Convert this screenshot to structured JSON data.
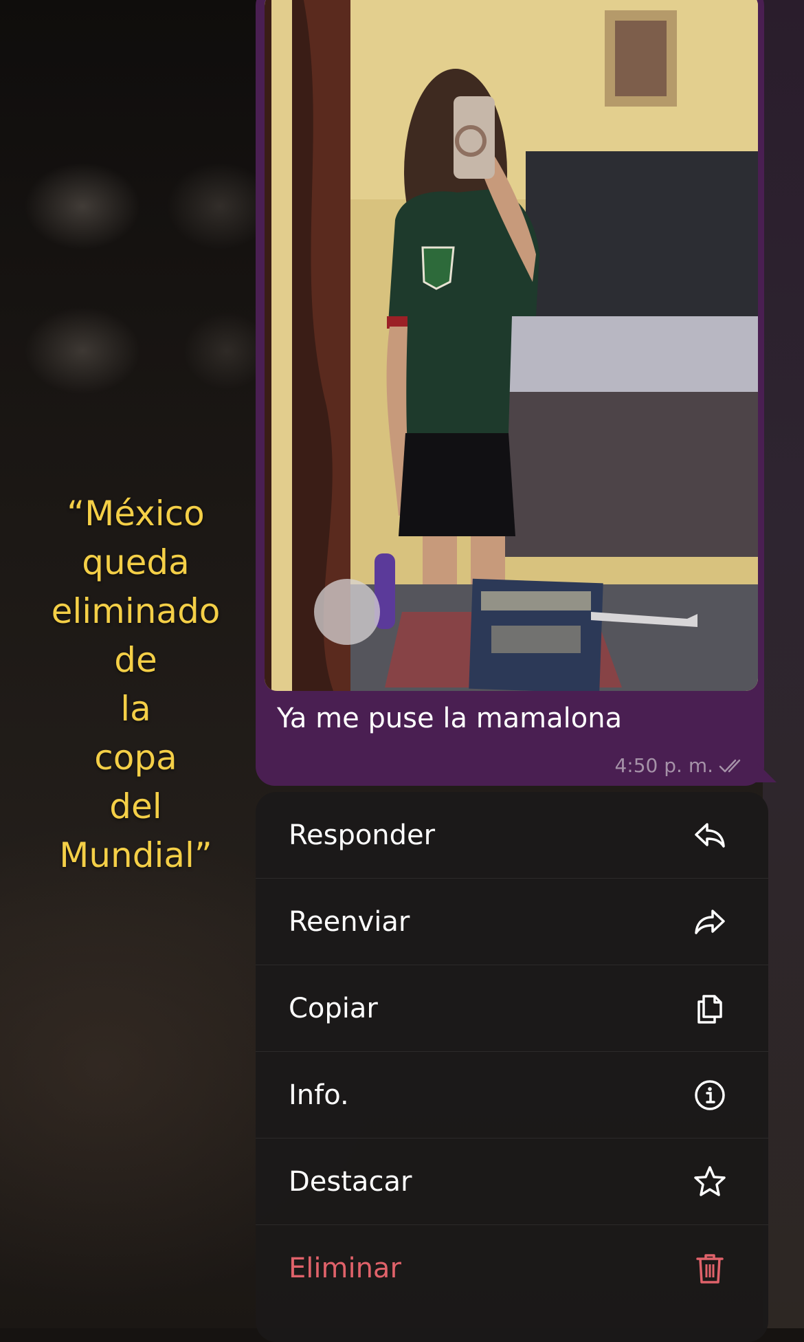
{
  "caption": {
    "lines": [
      "“México",
      "queda",
      "eliminado",
      "de",
      "la",
      "copa",
      "del",
      "Mundial”"
    ]
  },
  "message": {
    "text": "Ya me puse la mamalona",
    "time": "4:50 p. m.",
    "status_icon": "double-check-icon"
  },
  "menu": {
    "items": [
      {
        "label": "Responder",
        "icon": "reply-icon"
      },
      {
        "label": "Reenviar",
        "icon": "forward-icon"
      },
      {
        "label": "Copiar",
        "icon": "copy-icon"
      },
      {
        "label": "Info.",
        "icon": "info-icon"
      },
      {
        "label": "Destacar",
        "icon": "star-icon"
      },
      {
        "label": "Eliminar",
        "icon": "trash-icon",
        "destructive": true
      }
    ]
  },
  "colors": {
    "bubble": "#4a1f52",
    "caption": "#f4cf47",
    "destructive": "#e0626a",
    "menu_bg": "#1b1919"
  }
}
